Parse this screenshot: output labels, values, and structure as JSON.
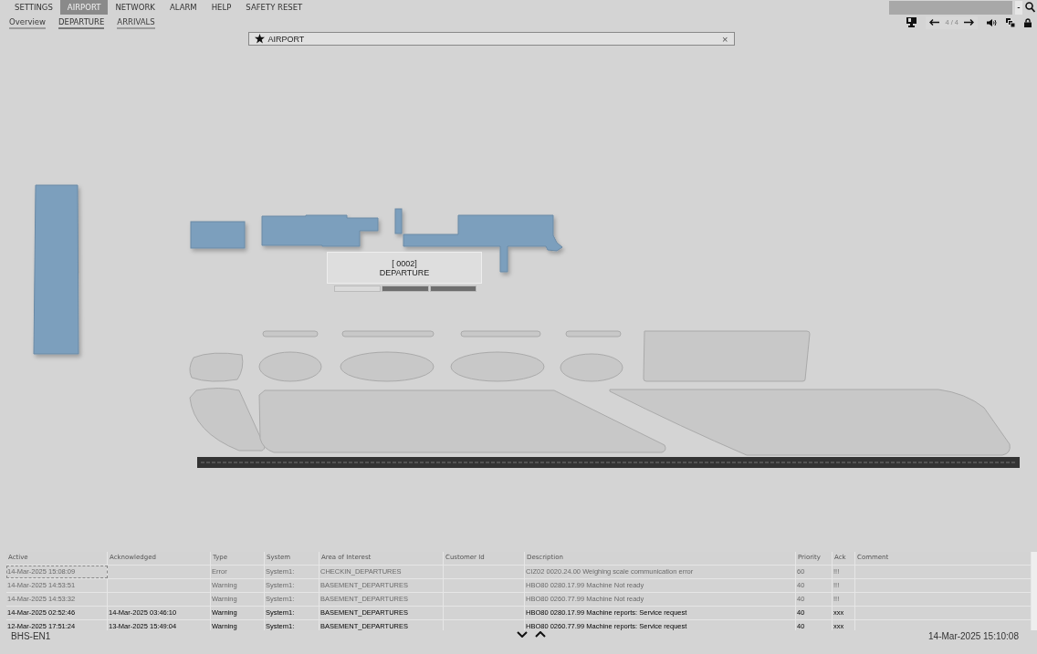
{
  "menu": [
    {
      "label": "SETTINGS",
      "selected": false
    },
    {
      "label": "AIRPORT",
      "selected": true
    },
    {
      "label": "NETWORK",
      "selected": false
    },
    {
      "label": "ALARM",
      "selected": false
    },
    {
      "label": "HELP",
      "selected": false
    },
    {
      "label": "SAFETY RESET",
      "selected": false
    }
  ],
  "submenu": [
    {
      "label": "Overview",
      "selected": false
    },
    {
      "label": "DEPARTURE",
      "selected": true
    },
    {
      "label": "ARRIVALS",
      "selected": false
    }
  ],
  "search": {
    "dropdown": "-"
  },
  "pager": {
    "text": "4 / 4"
  },
  "view": {
    "title": "AIRPORT",
    "close": "×"
  },
  "area_label": {
    "code": "[ 0002]",
    "name": "DEPARTURE",
    "segments": [
      {
        "on": false
      },
      {
        "on": true
      },
      {
        "on": true
      }
    ]
  },
  "alarms": {
    "columns": [
      "Active",
      "Acknowledged",
      "Type",
      "System",
      "Area of Interest",
      "Customer Id",
      "Description",
      "Priority",
      "Ack",
      "Comment"
    ],
    "rows": [
      {
        "dimmed": true,
        "selected": true,
        "cells": [
          "14-Mar-2025  15:08:09",
          "",
          "Error",
          "System1:",
          "CHECKIN_DEPARTURES",
          "",
          "CIZ02 0020.24.00 Weighing scale communication error",
          "60",
          "!!!",
          ""
        ]
      },
      {
        "dimmed": true,
        "selected": false,
        "cells": [
          "14-Mar-2025  14:53:51",
          "",
          "Warning",
          "System1:",
          "BASEMENT_DEPARTURES",
          "",
          "HBO80 0280.17.99 Machine Not ready",
          "40",
          "!!!",
          ""
        ]
      },
      {
        "dimmed": true,
        "selected": false,
        "cells": [
          "14-Mar-2025  14:53:32",
          "",
          "Warning",
          "System1:",
          "BASEMENT_DEPARTURES",
          "",
          "HBO80 0260.77.99 Machine Not ready",
          "40",
          "!!!",
          ""
        ]
      },
      {
        "dimmed": false,
        "selected": false,
        "cells": [
          "14-Mar-2025  02:52:46",
          "14-Mar-2025  03:46:10",
          "Warning",
          "System1:",
          "BASEMENT_DEPARTURES",
          "",
          "HBO80 0280.17.99 Machine reports: Service request",
          "40",
          "xxx",
          ""
        ]
      },
      {
        "dimmed": false,
        "selected": false,
        "cells": [
          "12-Mar-2025  17:51:24",
          "13-Mar-2025  15:49:04",
          "Warning",
          "System1:",
          "BASEMENT_DEPARTURES",
          "",
          "HBO80 0260.77.99 Machine reports: Service request",
          "40",
          "xxx",
          ""
        ]
      }
    ]
  },
  "status_bar": {
    "station": "BHS-EN1",
    "datetime": "14-Mar-2025  15:10:08"
  }
}
